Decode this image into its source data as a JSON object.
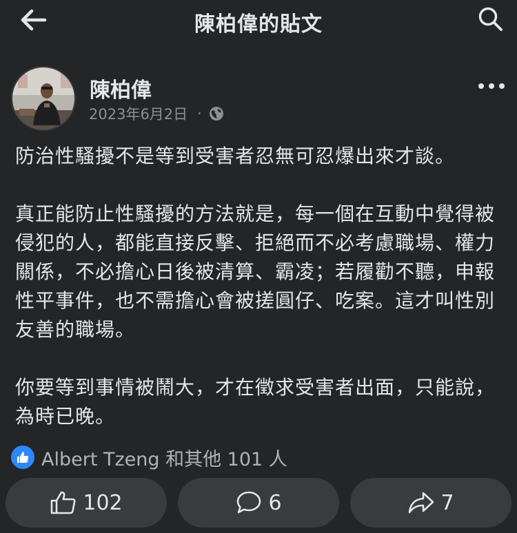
{
  "topbar": {
    "title": "陳柏偉的貼文",
    "back_icon": "arrow-left-icon",
    "search_icon": "search-icon"
  },
  "post": {
    "author": "陳柏偉",
    "date": "2023年6月2日",
    "separator": "·",
    "audience_icon": "globe-icon",
    "more_icon": "more-horizontal-icon",
    "paragraphs": [
      "防治性騷擾不是等到受害者忍無可忍爆出來才談。",
      "真正能防止性騷擾的方法就是，每一個在互動中覺得被侵犯的人，都能直接反擊、拒絕而不必考慮職場、權力關係，不必擔心日後被清算、霸凌；若履勸不聽，申報性平事件，也不需擔心會被搓圓仔、吃案。這才叫性別友善的職場。",
      "你要等到事情被鬧大，才在徵求受害者出面，只能說，為時已晚。"
    ]
  },
  "reactions": {
    "summary": "Albert Tzeng 和其他 101 人",
    "icon": "like-reaction-icon"
  },
  "actions": {
    "like_count": "102",
    "comment_count": "6",
    "share_count": "7"
  },
  "colors": {
    "background": "#242526",
    "button": "#3a3b3c",
    "accent": "#2d88ff",
    "text": "#e4e6eb",
    "muted": "#8e9096"
  }
}
